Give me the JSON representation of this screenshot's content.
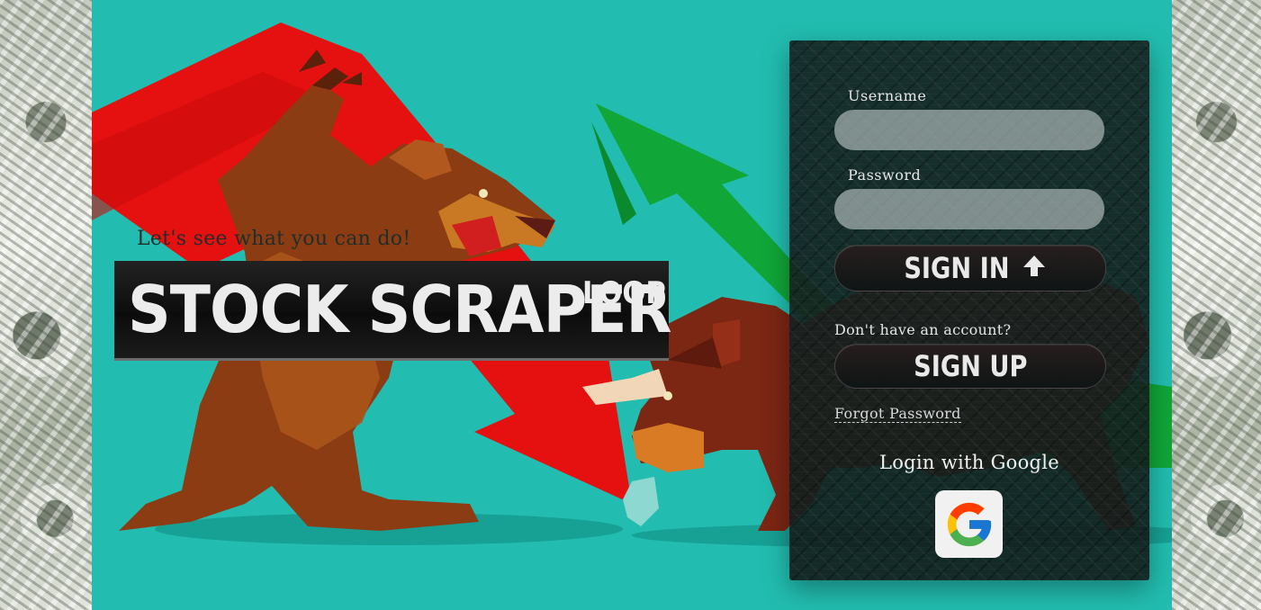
{
  "hero": {
    "tagline": "Let's see what you can do!",
    "brand_main": "STOCK SCRAPER",
    "brand_sup": "LOOP"
  },
  "login": {
    "username_label": "Username",
    "username_value": "",
    "password_label": "Password",
    "password_value": "",
    "sign_in_label": "SIGN IN",
    "sign_in_icon": "arrow-up-icon",
    "no_account_text": "Don't have an account?",
    "sign_up_label": "SIGN UP",
    "forgot_password_link": "Forgot Password",
    "google_title": "Login with Google",
    "google_icon": "google-logo-icon"
  },
  "colors": {
    "scene_background": "#22bdb0",
    "panel_background": "#1a2b29",
    "bear_arrow_red": "#e01010",
    "bull_arrow_green": "#13a33a",
    "bear_brown": "#8b3a12",
    "bull_red_brown": "#7a2414"
  }
}
